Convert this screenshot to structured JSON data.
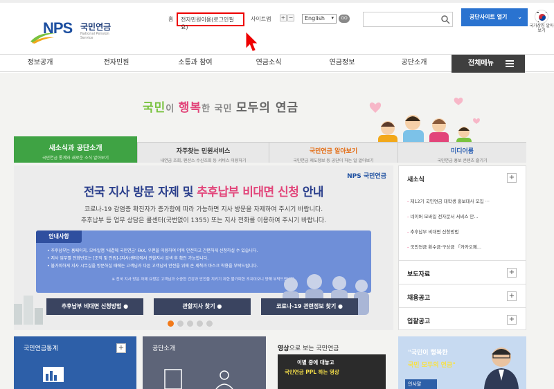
{
  "header": {
    "logo_brand": "NPS",
    "logo_name": "국민연금",
    "logo_en": "National Pension Service",
    "util": {
      "home": "홈",
      "login": "전자민원이용(로그인필요)",
      "sitemap": "사이트맵",
      "zoom_in": "+",
      "zoom_out": "−",
      "language": "English",
      "go": "GO"
    },
    "search_placeholder": "",
    "site_button": "공단사이트 열기",
    "flag_label": "국가상징 알아보기"
  },
  "gnb": {
    "items": [
      "정보공개",
      "전자민원",
      "소통과 참여",
      "연금소식",
      "연금정보",
      "공단소개"
    ],
    "all_menu": "전체메뉴"
  },
  "hero": {
    "slogan_a": "국민",
    "slogan_b": "이 ",
    "slogan_c": "행복",
    "slogan_d": "한 국민 ",
    "slogan_e": "모두의 연금"
  },
  "tabs": [
    {
      "title": "새소식과 공단소개",
      "sub": "국민연금 통계와 새로운 소식 알아보기"
    },
    {
      "title": "자주찾는 민원서비스",
      "sub": "내연금 조회, 펜션스 수신조회 등 서비스 이용하기"
    },
    {
      "title": "국민연금 알아보기",
      "sub": "국민연금 제도정보 등 공단이 하는 일 알아보기"
    },
    {
      "title": "미디어룸",
      "sub": "국민연금 홍보 콘텐츠 즐기기"
    }
  ],
  "banner": {
    "nps": "NPS 국민연금",
    "title_a": "전국 지사 방문 자제 및 ",
    "title_b": "추후납부 비대면 신청",
    "title_c": " 안내",
    "sub1": "코로나-19 감염증 확진자가 증가함에 따라 가능하면 지사 방문을 자제하여 주시기 바랍니다.",
    "sub2": "추후납부 등 업무 상담은 콜센터(국번없이 1355) 또는 지사 전화를 이용하여 주시기 바랍니다.",
    "notice_title": "안내사항",
    "notice_items": [
      "• 추후납부는 홈페이지, 모바일앱 '내곁에 국민연금' FAX, 우편을 이용하여 더욱 안전하고 간편하게 신청하실 수 있습니다.",
      "• 지사 업무별 전화번호는 [조직 및 인원]-[지사/센터]에서 관할지사 검색 후 확인 가능합니다.",
      "• 불가피하게 지사 시무실을 방문하실 때에는 고객님과 다른 고객님의 안전을 위해 손 세척과 마스크 착용을 부탁드립니다."
    ],
    "notice_note": "※ 전국 지사 방문 자제 요청은 고객님과 소중한 건강과 안전을 지키기 위한 불가피한 조치이오니 양해 부탁드립니다.",
    "buttons": [
      "추후납부 비대면 신청방법",
      "관할지사 찾기",
      "코로나-19 관련정보 찾기"
    ],
    "slide_count": 5,
    "active_slide": 0
  },
  "news": {
    "title": "새소식",
    "items": [
      "제12기 국민연금 대학생 홍보대사 모집 ···",
      "네이버 모바일 전자문서 서비스 안...",
      "추후납부 비대면 신청방법",
      "국민연금 환수금·구상금 「카카오페..."
    ],
    "sections": [
      "보도자료",
      "채용공고",
      "입찰공고"
    ]
  },
  "cards": {
    "stats": "국민연금통계",
    "about": "공단소개",
    "video_a": "영상",
    "video_b": "으로 보는 국민연금",
    "video_line1": "이별 중에 대놓고",
    "video_line2": "국민연금 PPL 하는 영상",
    "promo1": "\"국민이 행복한",
    "promo2": "국민 모두의 연금\"",
    "greeting": "인사말"
  },
  "colors": {
    "brand_blue": "#1d4fa0",
    "green_tab": "#3fa344",
    "highlight_pink": "#e2457a",
    "login_highlight": "#ee0000"
  }
}
